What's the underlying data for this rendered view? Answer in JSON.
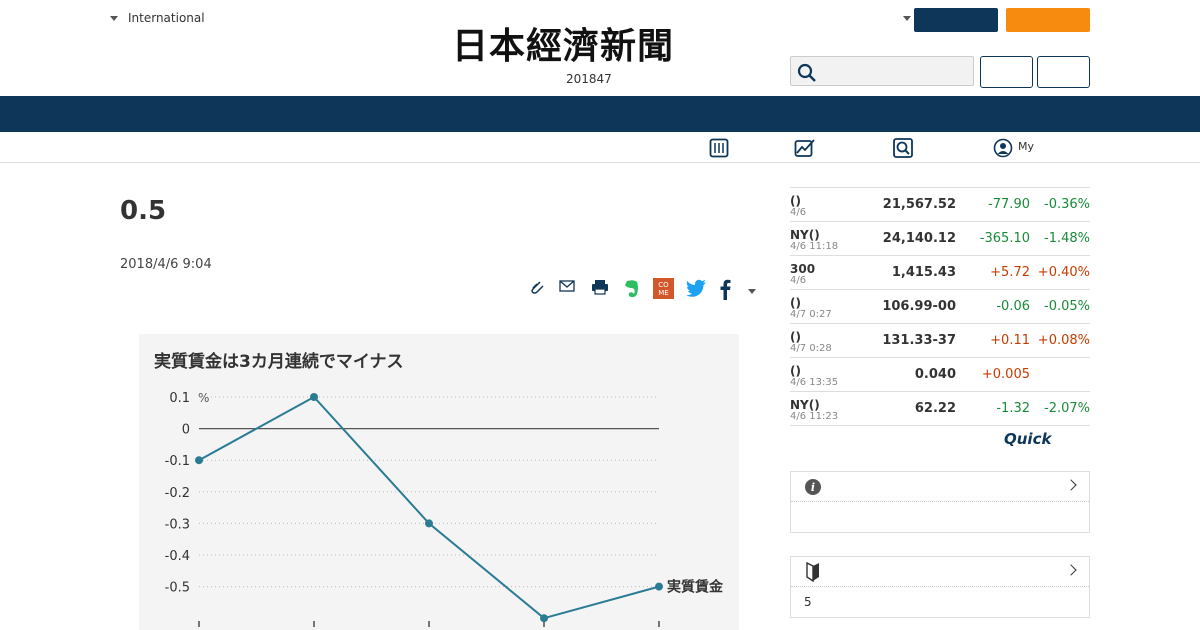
{
  "header": {
    "region_label": "International",
    "logo_text": "日本經濟新聞",
    "edition_number": "201847"
  },
  "subnav": {
    "my_label": "My"
  },
  "article": {
    "headline": "0.5",
    "date": "2018/4/6 9:04"
  },
  "chart_data": {
    "type": "line",
    "title": "実質賃金は3カ月連続でマイナス",
    "yunit": "%",
    "ylim": [
      -0.6,
      0.1
    ],
    "yticks": [
      "0.1",
      "0",
      "-0.1",
      "-0.2",
      "-0.3",
      "-0.4",
      "-0.5"
    ],
    "series": [
      {
        "name": "実質賃金",
        "values": [
          -0.1,
          0.1,
          -0.3,
          -0.6,
          -0.5
        ]
      }
    ],
    "line_color": "#2a7b94"
  },
  "market": {
    "rows": [
      {
        "name": "()",
        "time": "4/6",
        "value": "21,567.52",
        "change": "-77.90",
        "pct": "-0.36%",
        "dir": "down"
      },
      {
        "name": "NY()",
        "time": "4/6 11:18",
        "value": "24,140.12",
        "change": "-365.10",
        "pct": "-1.48%",
        "dir": "down"
      },
      {
        "name": "300",
        "time": "4/6",
        "value": "1,415.43",
        "change": "+5.72",
        "pct": "+0.40%",
        "dir": "up"
      },
      {
        "name": "()",
        "time": "4/7 0:27",
        "value": "106.99-00",
        "change": "-0.06",
        "pct": "-0.05%",
        "dir": "down"
      },
      {
        "name": "()",
        "time": "4/7 0:28",
        "value": "131.33-37",
        "change": "+0.11",
        "pct": "+0.08%",
        "dir": "up"
      },
      {
        "name": "()",
        "time": "4/6 13:35",
        "value": "0.040",
        "change": "+0.005",
        "pct": "",
        "dir": "up"
      },
      {
        "name": "NY()",
        "time": "4/6 11:23",
        "value": "62.22",
        "change": "-1.32",
        "pct": "-2.07%",
        "dir": "down"
      }
    ],
    "brand": "Quick"
  },
  "sidebar": {
    "box2_text": "5"
  },
  "colors": {
    "navy": "#0e3659",
    "orange": "#f68b10",
    "up": "#c63d00",
    "down": "#1a8a3a"
  }
}
